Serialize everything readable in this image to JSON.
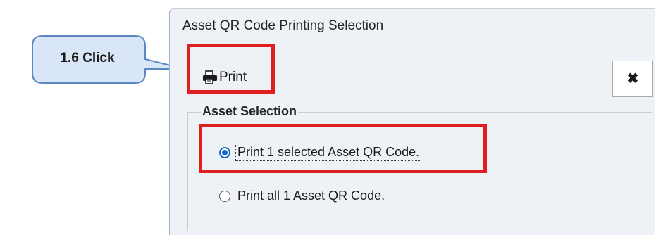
{
  "dialog": {
    "title": "Asset QR Code Printing Selection",
    "print_label": "Print",
    "close_icon": "close-icon",
    "print_icon": "printer-icon"
  },
  "asset_selection": {
    "group_title": "Asset Selection",
    "options": [
      {
        "label": "Print 1 selected Asset QR Code.",
        "selected": true
      },
      {
        "label": "Print all 1 Asset QR Code.",
        "selected": false
      }
    ]
  },
  "annotation": {
    "callout_text": "1.6 Click",
    "callout_fill": "#d9e6f7",
    "callout_border": "#5b87c5",
    "highlight_color": "#e02020"
  }
}
